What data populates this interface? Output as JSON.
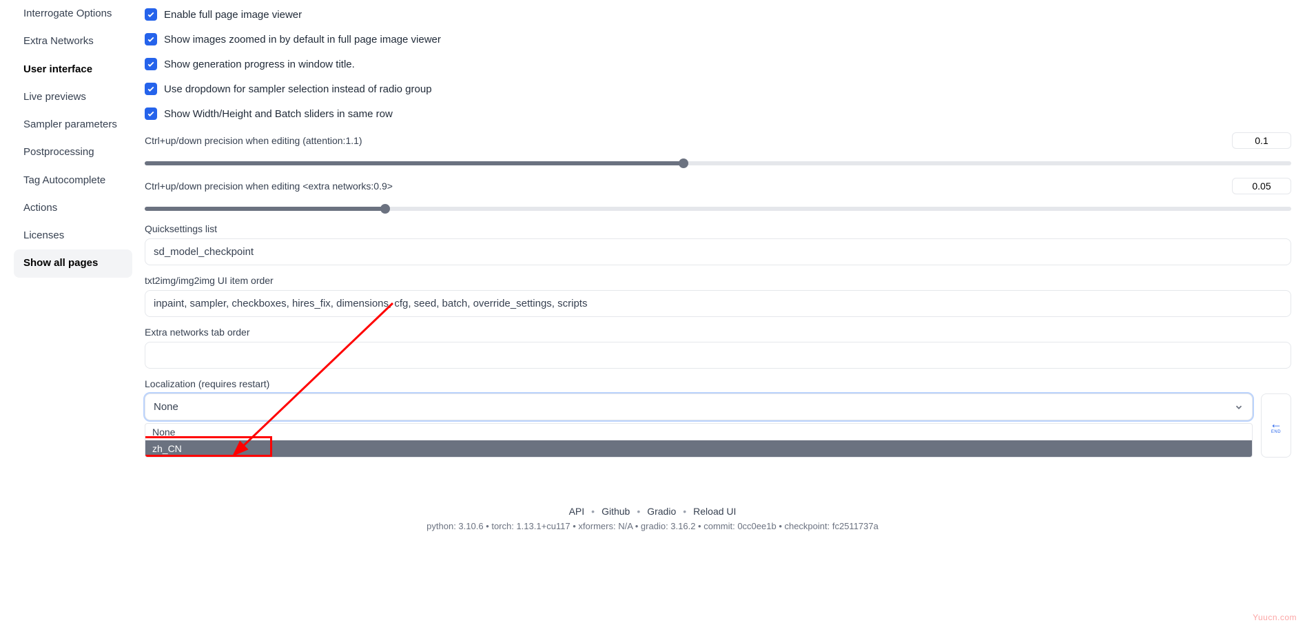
{
  "sidebar": {
    "items": [
      {
        "label": "Interrogate Options"
      },
      {
        "label": "Extra Networks"
      },
      {
        "label": "User interface"
      },
      {
        "label": "Live previews"
      },
      {
        "label": "Sampler parameters"
      },
      {
        "label": "Postprocessing"
      },
      {
        "label": "Tag Autocomplete"
      },
      {
        "label": "Actions"
      },
      {
        "label": "Licenses"
      },
      {
        "label": "Show all pages"
      }
    ]
  },
  "checkboxes": {
    "full_page_viewer": "Enable full page image viewer",
    "zoomed_in": "Show images zoomed in by default in full page image viewer",
    "window_title_progress": "Show generation progress in window title.",
    "dropdown_sampler": "Use dropdown for sampler selection instead of radio group",
    "width_height_row": "Show Width/Height and Batch sliders in same row"
  },
  "sliders": {
    "attention_precision": {
      "label": "Ctrl+up/down precision when editing (attention:1.1)",
      "value": "0.1"
    },
    "extra_networks_precision": {
      "label": "Ctrl+up/down precision when editing <extra networks:0.9>",
      "value": "0.05"
    }
  },
  "fields": {
    "quicksettings": {
      "label": "Quicksettings list",
      "value": "sd_model_checkpoint"
    },
    "ui_item_order": {
      "label": "txt2img/img2img UI item order",
      "value": "inpaint, sampler, checkboxes, hires_fix, dimensions, cfg, seed, batch, override_settings, scripts"
    },
    "extra_networks_tab_order": {
      "label": "Extra networks tab order",
      "value": ""
    }
  },
  "localization": {
    "label": "Localization (requires restart)",
    "selected": "None",
    "options": [
      "None",
      "zh_CN"
    ]
  },
  "footer": {
    "links": [
      "API",
      "Github",
      "Gradio",
      "Reload UI"
    ],
    "meta": "python: 3.10.6  •  torch: 1.13.1+cu117  •  xformers: N/A  •  gradio: 3.16.2  •  commit: 0cc0ee1b  •  checkpoint: fc2511737a"
  },
  "icons": {
    "refresh": "↩",
    "end_label": "END"
  },
  "watermark": "Yuucn.com"
}
